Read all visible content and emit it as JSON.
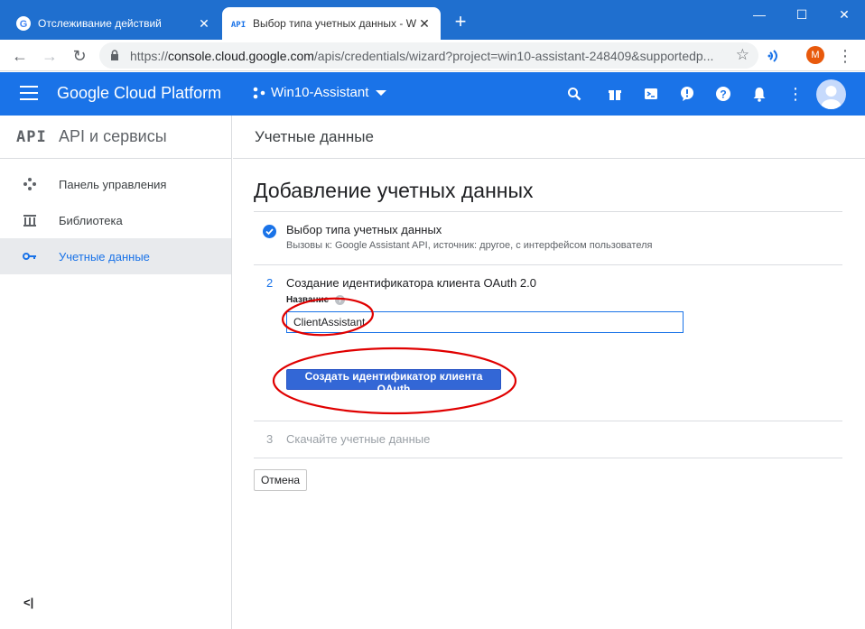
{
  "browser": {
    "tabs": [
      {
        "title": "Отслеживание действий",
        "favicon": "google-icon"
      },
      {
        "title": "Выбор типа учетных данных - W",
        "favicon": "api-icon"
      }
    ],
    "url_scheme": "https://",
    "url_host": "console.cloud.google.com",
    "url_path": "/apis/credentials/wizard?project=win10-assistant-248409&supportedp...",
    "profile_initial": "M"
  },
  "header": {
    "brand": "Google Cloud Platform",
    "project": "Win10-Assistant"
  },
  "sidebar": {
    "logo": "API",
    "title": "API и сервисы",
    "items": [
      {
        "label": "Панель управления",
        "icon": "dashboard-icon"
      },
      {
        "label": "Библиотека",
        "icon": "library-icon"
      },
      {
        "label": "Учетные данные",
        "icon": "key-icon"
      }
    ],
    "collapse": "<|"
  },
  "main": {
    "page_title": "Учетные данные",
    "heading": "Добавление учетных данных",
    "step1": {
      "title": "Выбор типа учетных данных",
      "subtitle": "Вызовы к: Google Assistant API, источник: другое, с интерфейсом пользователя"
    },
    "step2": {
      "number": "2",
      "title": "Создание идентификатора клиента OAuth 2.0",
      "field_label": "Название",
      "field_value": "ClientAssistant",
      "button": "Создать идентификатор клиента OAuth"
    },
    "step3": {
      "number": "3",
      "title": "Скачайте учетные данные"
    },
    "cancel": "Отмена"
  },
  "colors": {
    "brand_blue": "#1a73e8",
    "titlebar": "#1f6fcf",
    "annotation_red": "#e00000"
  }
}
